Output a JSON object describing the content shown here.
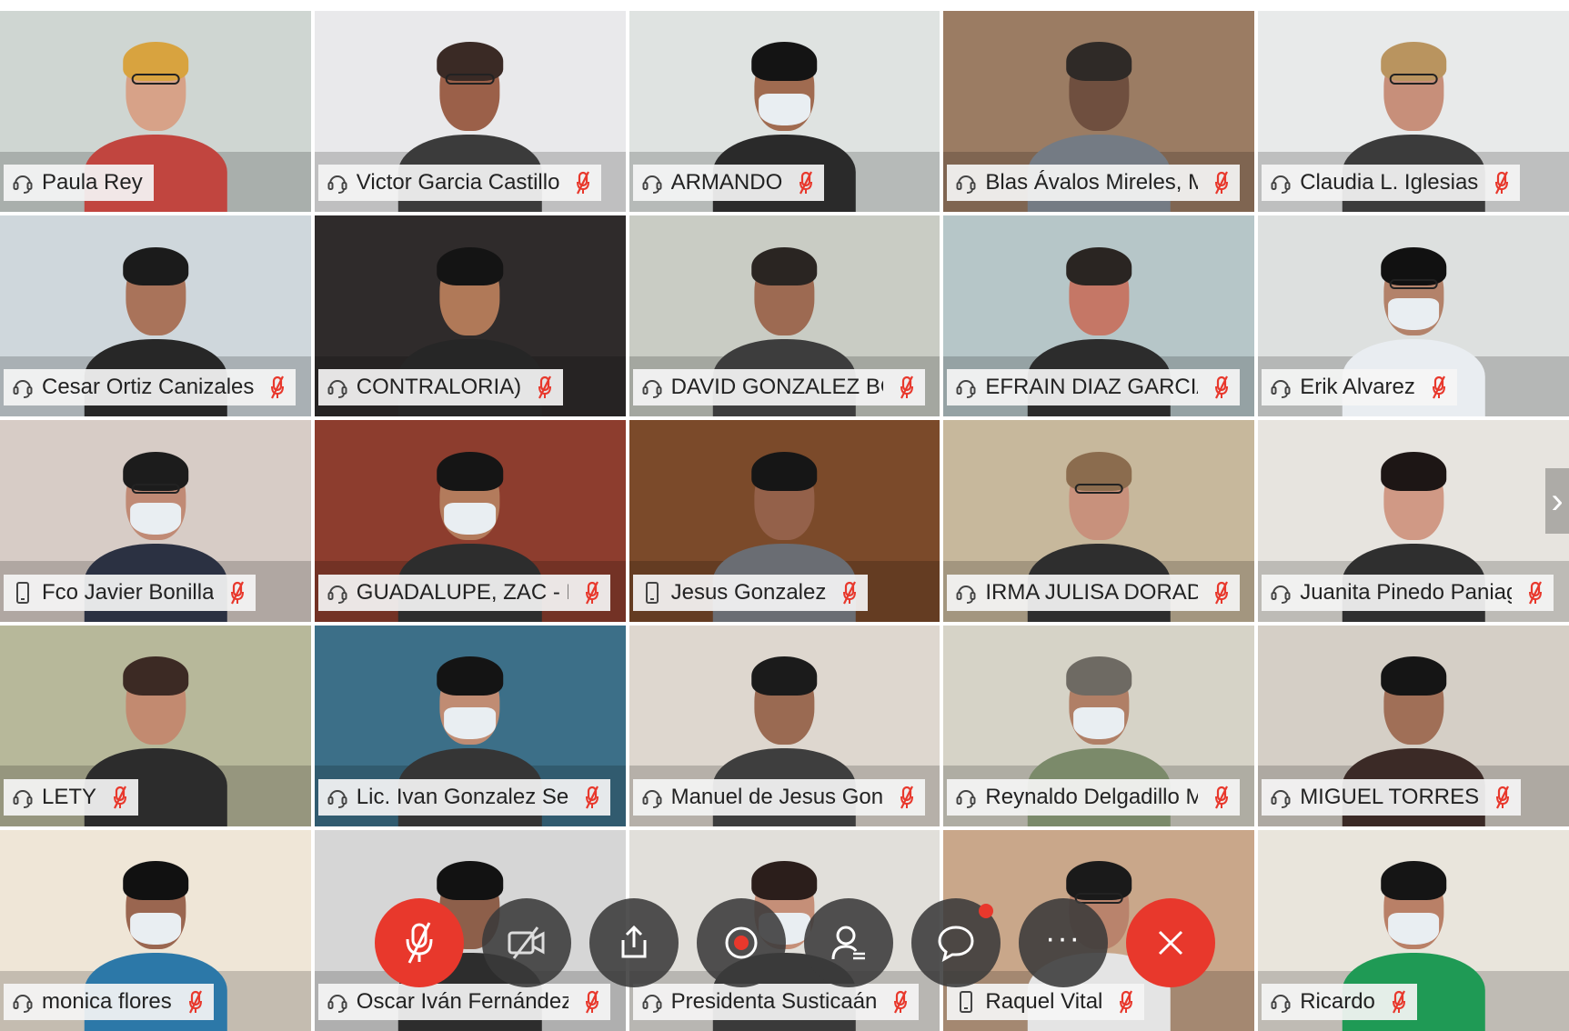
{
  "participants": [
    {
      "name": "Paula Rey",
      "device": "headset",
      "muted": false,
      "active": true,
      "wall": "#cfd6d2",
      "skin": "#d7a288",
      "hair": "#d8a33f",
      "shirt": "#c1453f",
      "mask": false,
      "glasses": true
    },
    {
      "name": "Victor Garcia Castillo",
      "device": "headset",
      "muted": true,
      "active": false,
      "wall": "#e9e9eb",
      "skin": "#9b6049",
      "hair": "#3a2a25",
      "shirt": "#3b3b3b",
      "mask": false,
      "glasses": true
    },
    {
      "name": "ARMANDO",
      "device": "headset",
      "muted": true,
      "active": false,
      "wall": "#dfe3e1",
      "skin": "#a06b50",
      "hair": "#141414",
      "shirt": "#2a2a2a",
      "mask": true,
      "glasses": false
    },
    {
      "name": "Blas Ávalos Mireles, Mpi...",
      "device": "headset",
      "muted": true,
      "active": false,
      "wall": "#9b7c63",
      "skin": "#6f4f3f",
      "hair": "#2f2a27",
      "shirt": "#747b84",
      "mask": false,
      "glasses": false
    },
    {
      "name": "Claudia L. Iglesias",
      "device": "headset",
      "muted": true,
      "active": false,
      "wall": "#e8eaea",
      "skin": "#c78f7a",
      "hair": "#b9945f",
      "shirt": "#3b3b3b",
      "mask": false,
      "glasses": true
    },
    {
      "name": "Cesar Ortiz Canizales",
      "device": "headset",
      "muted": true,
      "active": false,
      "wall": "#cfd7dc",
      "skin": "#a9735a",
      "hair": "#1b1b1b",
      "shirt": "#272727",
      "mask": false,
      "glasses": false
    },
    {
      "name": "CONTRALORIA)",
      "device": "headset",
      "muted": true,
      "active": false,
      "wall": "#2f2b2b",
      "skin": "#b07958",
      "hair": "#141414",
      "shirt": "#262626",
      "mask": false,
      "glasses": false
    },
    {
      "name": "DAVID GONZALEZ BOB...",
      "device": "headset",
      "muted": true,
      "active": false,
      "wall": "#c9ccc4",
      "skin": "#9d6a52",
      "hair": "#2a2522",
      "shirt": "#3d3d3d",
      "mask": false,
      "glasses": false
    },
    {
      "name": "EFRAIN DIAZ GARCIA",
      "device": "headset",
      "muted": true,
      "active": false,
      "wall": "#b6c6c8",
      "skin": "#c57766",
      "hair": "#2a2522",
      "shirt": "#2c2c2c",
      "mask": false,
      "glasses": false
    },
    {
      "name": "Erik Alvarez",
      "device": "headset",
      "muted": true,
      "active": false,
      "wall": "#dde0df",
      "skin": "#b3826a",
      "hair": "#111111",
      "shirt": "#e9edf1",
      "mask": true,
      "glasses": true
    },
    {
      "name": "Fco Javier Bonilla",
      "device": "phone",
      "muted": true,
      "active": false,
      "wall": "#d7ccc6",
      "skin": "#c08a75",
      "hair": "#1c1c1c",
      "shirt": "#2b3142",
      "mask": true,
      "glasses": true
    },
    {
      "name": "GUADALUPE, ZAC - Mtr...",
      "device": "headset",
      "muted": true,
      "active": false,
      "wall": "#8d3d2e",
      "skin": "#b37b5c",
      "hair": "#151515",
      "shirt": "#2d2d2d",
      "mask": true,
      "glasses": false
    },
    {
      "name": "Jesus Gonzalez",
      "device": "phone",
      "muted": true,
      "active": false,
      "wall": "#7b4a2a",
      "skin": "#94614a",
      "hair": "#161616",
      "shirt": "#6a6d73",
      "mask": false,
      "glasses": false
    },
    {
      "name": "IRMA JULISA DORADO ...",
      "device": "headset",
      "muted": true,
      "active": false,
      "wall": "#c7b89c",
      "skin": "#c8917c",
      "hair": "#8b6c4e",
      "shirt": "#2e2e2e",
      "mask": false,
      "glasses": true
    },
    {
      "name": "Juanita Pinedo Paniagua",
      "device": "headset",
      "muted": true,
      "active": false,
      "wall": "#e7e4df",
      "skin": "#d09985",
      "hair": "#1d1615",
      "shirt": "#2f2f2f",
      "mask": false,
      "glasses": false
    },
    {
      "name": "LETY",
      "device": "headset",
      "muted": true,
      "active": false,
      "wall": "#b7b89a",
      "skin": "#c28a70",
      "hair": "#3c2a24",
      "shirt": "#2c2c2c",
      "mask": false,
      "glasses": false
    },
    {
      "name": "Lic. Ivan Gonzalez Secret...",
      "device": "headset",
      "muted": true,
      "active": false,
      "wall": "#3c6f88",
      "skin": "#c08c73",
      "hair": "#141414",
      "shirt": "#353535",
      "mask": true,
      "glasses": false
    },
    {
      "name": "Manuel de Jesus Gonzal...",
      "device": "headset",
      "muted": true,
      "active": false,
      "wall": "#ded7cf",
      "skin": "#9a6a52",
      "hair": "#1b1b1b",
      "shirt": "#3e3e3e",
      "mask": false,
      "glasses": false
    },
    {
      "name": "Reynaldo Delgadillo Mo...",
      "device": "headset",
      "muted": true,
      "active": false,
      "wall": "#d6d3c7",
      "skin": "#b07f66",
      "hair": "#6e6a63",
      "shirt": "#7b8a6a",
      "mask": true,
      "glasses": false
    },
    {
      "name": "MIGUEL TORRES",
      "device": "headset",
      "muted": true,
      "active": false,
      "wall": "#d5cfc6",
      "skin": "#a06f57",
      "hair": "#151515",
      "shirt": "#3b2a26",
      "mask": false,
      "glasses": false
    },
    {
      "name": "monica flores",
      "device": "headset",
      "muted": true,
      "active": false,
      "wall": "#efe6d7",
      "skin": "#9a6650",
      "hair": "#111111",
      "shirt": "#2c78a8",
      "mask": true,
      "glasses": false
    },
    {
      "name": "Oscar Iván Fernández N...",
      "device": "headset",
      "muted": true,
      "active": false,
      "wall": "#d6d6d6",
      "skin": "#8d5f4a",
      "hair": "#121212",
      "shirt": "#2d2d2d",
      "mask": false,
      "glasses": false
    },
    {
      "name": "Presidenta Susticaán",
      "device": "headset",
      "muted": true,
      "active": false,
      "wall": "#e1dfda",
      "skin": "#c58f78",
      "hair": "#2b1e1b",
      "shirt": "#3a3a3a",
      "mask": true,
      "glasses": false
    },
    {
      "name": "Raquel Vital",
      "device": "phone",
      "muted": true,
      "active": false,
      "wall": "#c9a78a",
      "skin": "#b9836c",
      "hair": "#1a1a1a",
      "shirt": "#e4e4e4",
      "mask": false,
      "glasses": true
    },
    {
      "name": "Ricardo",
      "device": "headset",
      "muted": true,
      "active": false,
      "wall": "#e9e5dc",
      "skin": "#b98067",
      "hair": "#151515",
      "shirt": "#1f9a55",
      "mask": true,
      "glasses": false
    }
  ],
  "controls": [
    {
      "name": "mute-microphone-button",
      "icon": "microphone-muted-icon",
      "style": "red"
    },
    {
      "name": "camera-toggle-button",
      "icon": "camera-off-icon",
      "style": "dark"
    },
    {
      "name": "share-screen-button",
      "icon": "share-icon",
      "style": "dark"
    },
    {
      "name": "record-button",
      "icon": "record-icon",
      "style": "dark"
    },
    {
      "name": "participants-button",
      "icon": "participants-icon",
      "style": "dark"
    },
    {
      "name": "chat-button",
      "icon": "chat-bubble-icon",
      "style": "dark",
      "badge": true
    },
    {
      "name": "more-options-button",
      "icon": "more-icon",
      "style": "dark"
    },
    {
      "name": "leave-meeting-button",
      "icon": "close-icon",
      "style": "red"
    }
  ],
  "colors": {
    "accent": "#16b9cf",
    "danger": "#e8382c",
    "control_bg": "#3a3a3a",
    "label_bg": "#f5f5f5"
  },
  "next_page_icon": "chevron-right-icon"
}
